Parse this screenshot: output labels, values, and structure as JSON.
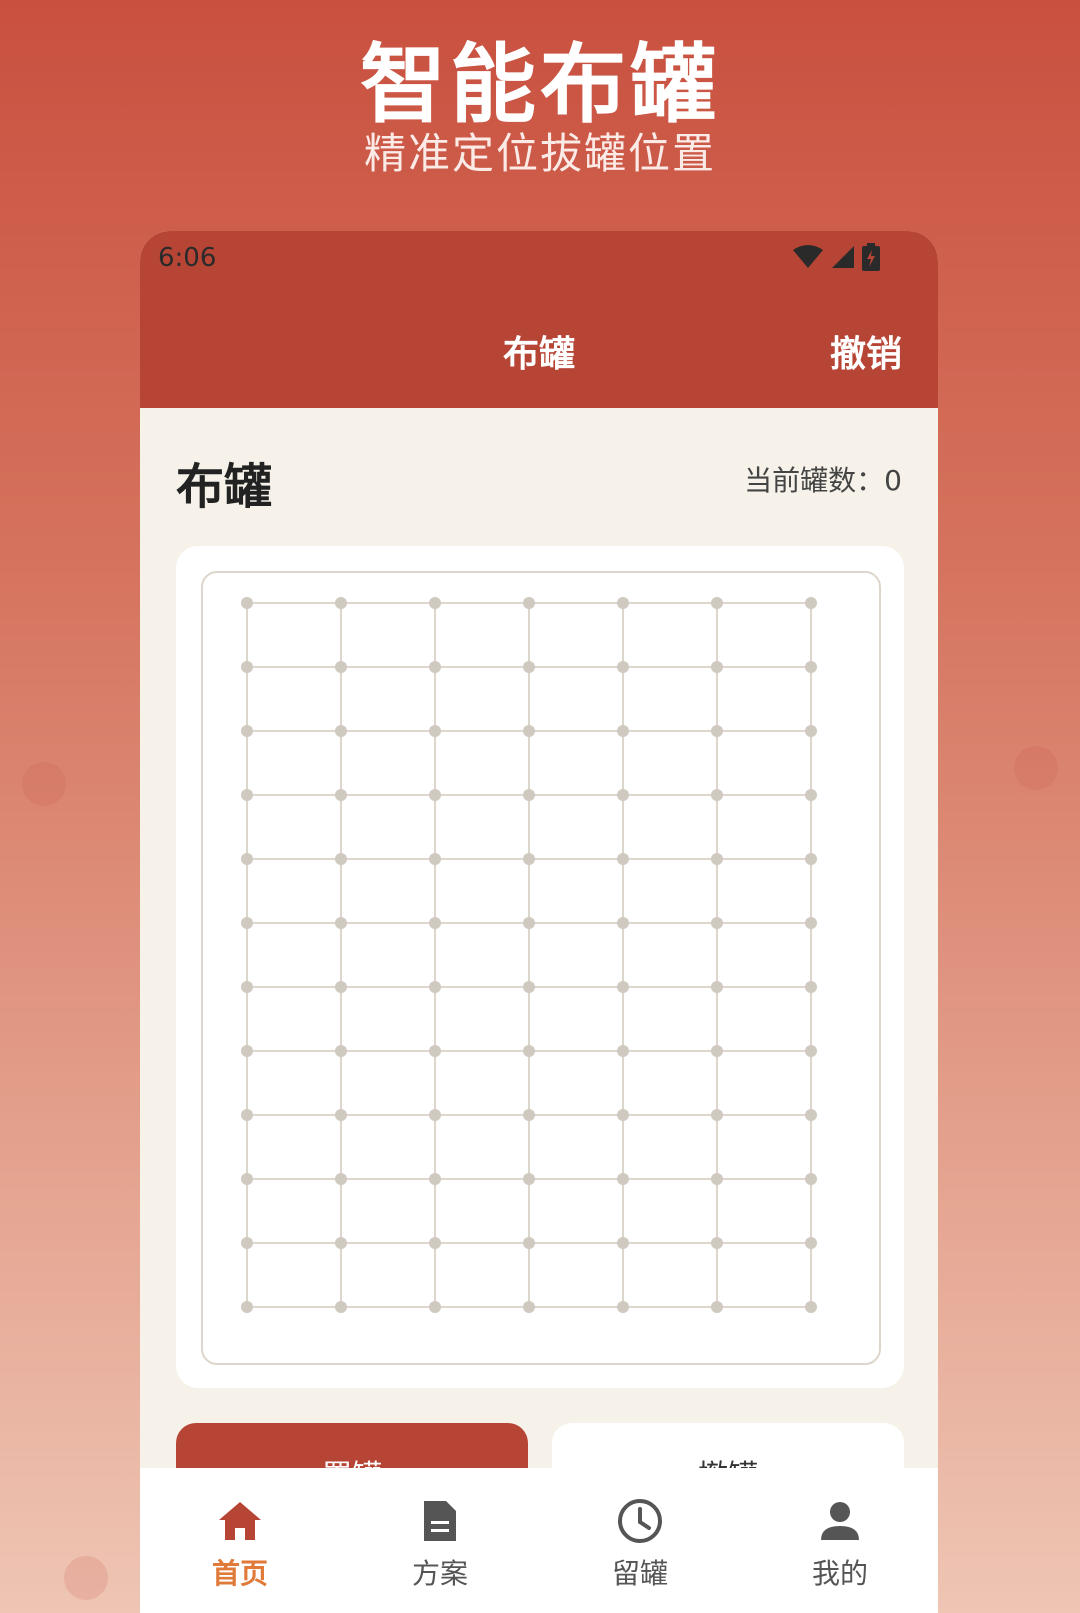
{
  "hero": {
    "title": "智能布罐",
    "subtitle": "精准定位拔罐位置"
  },
  "status_bar": {
    "time": "6:06",
    "icons": [
      "wifi-icon",
      "signal-icon",
      "battery-charging-icon"
    ]
  },
  "toolbar": {
    "title": "布罐",
    "undo_label": "撤销"
  },
  "main": {
    "section_title": "布罐",
    "count_label": "当前罐数：0"
  },
  "grid": {
    "columns": 7,
    "rows": 12,
    "line_color": "#ddd6cc",
    "dot_color": "#cfc9c0"
  },
  "actions": {
    "place_label": "置罐",
    "remove_label": "撤罐"
  },
  "tabs": [
    {
      "label": "首页",
      "icon": "home-icon",
      "active": true
    },
    {
      "label": "方案",
      "icon": "document-icon",
      "active": false
    },
    {
      "label": "留罐",
      "icon": "clock-icon",
      "active": false
    },
    {
      "label": "我的",
      "icon": "person-icon",
      "active": false
    }
  ],
  "colors": {
    "primary": "#b74536",
    "active_tab": "#e07a38",
    "background": "#f6f2ea"
  }
}
